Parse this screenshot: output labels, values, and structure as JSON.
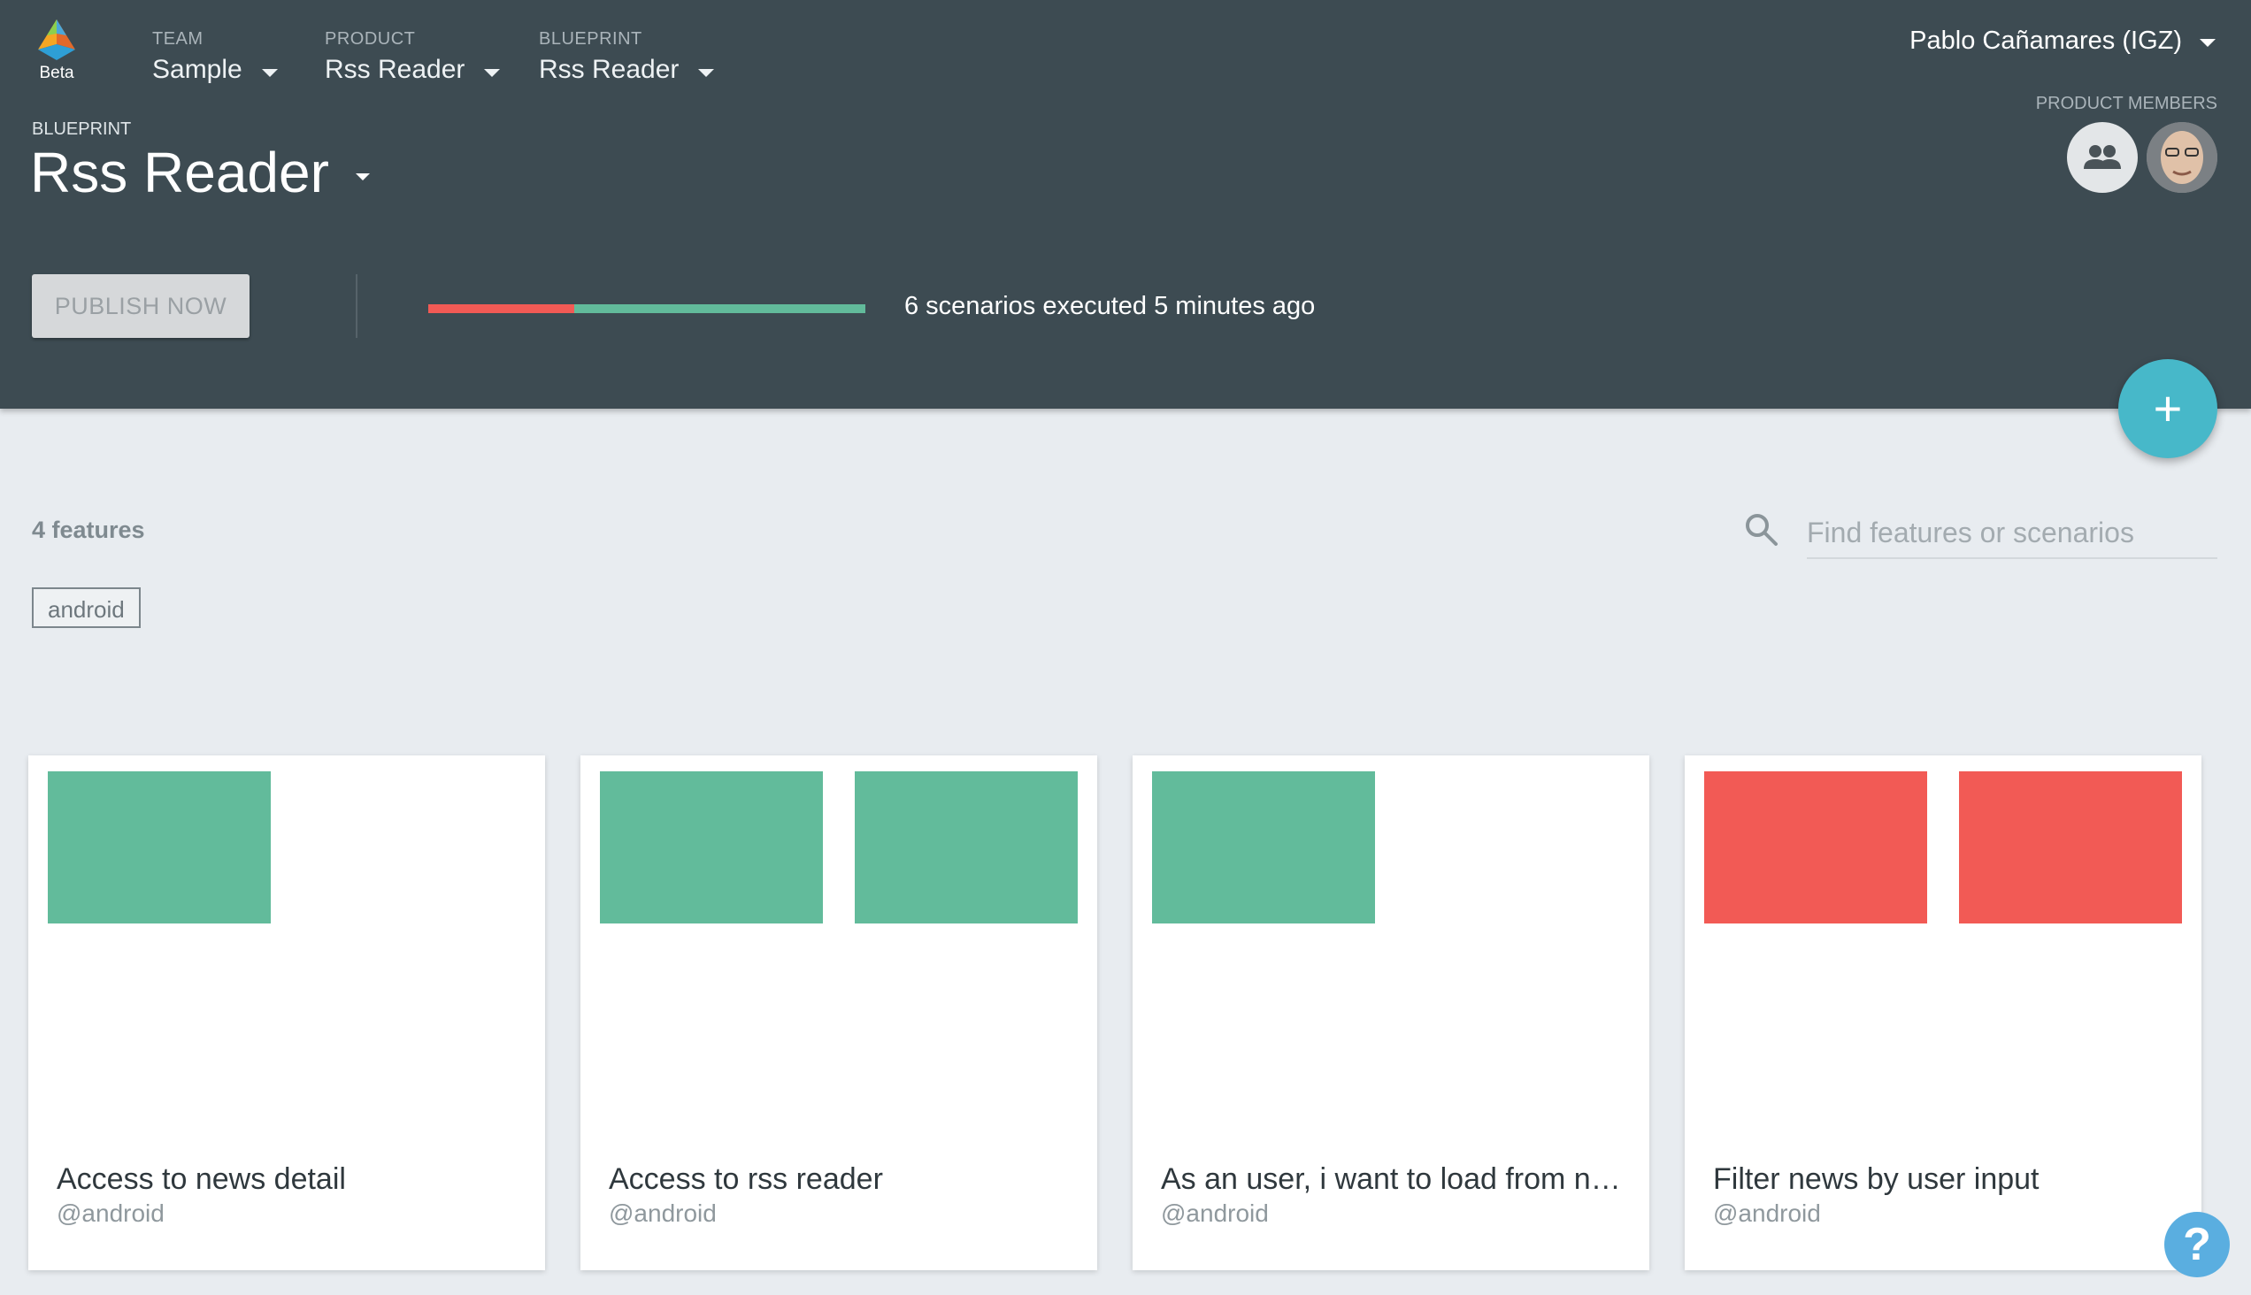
{
  "app": {
    "logo_text": "Beta"
  },
  "nav": {
    "team": {
      "label": "TEAM",
      "value": "Sample"
    },
    "product": {
      "label": "PRODUCT",
      "value": "Rss Reader"
    },
    "blueprint": {
      "label": "BLUEPRINT",
      "value": "Rss Reader"
    }
  },
  "blueprint": {
    "label": "BLUEPRINT",
    "title": "Rss Reader"
  },
  "user": {
    "name": "Pablo Cañamares (IGZ)"
  },
  "members": {
    "label": "PRODUCT MEMBERS"
  },
  "actions": {
    "publish_label": "PUBLISH NOW",
    "fab_label": "+"
  },
  "execution": {
    "summary": "6 scenarios executed 5 minutes ago",
    "failed_fraction": 0.333
  },
  "features": {
    "count_label": "4 features",
    "search_placeholder": "Find features or scenarios",
    "tag": "android",
    "items": [
      {
        "title": "Access to news detail",
        "tag": "@android",
        "scenarios": [
          "passed"
        ]
      },
      {
        "title": "Access to rss reader",
        "tag": "@android",
        "scenarios": [
          "passed",
          "passed"
        ]
      },
      {
        "title": "As an user, i want to load from net…",
        "tag": "@android",
        "scenarios": [
          "passed"
        ]
      },
      {
        "title": "Filter news by user input",
        "tag": "@android",
        "scenarios": [
          "failed",
          "failed"
        ]
      }
    ]
  },
  "help": {
    "label": "?"
  },
  "colors": {
    "header": "#3d4b52",
    "passed": "#62bb9b",
    "failed": "#f25a55",
    "accent": "#47b8c9"
  },
  "icons": {
    "search": "search-icon",
    "members": "group-icon",
    "help": "help-icon"
  }
}
